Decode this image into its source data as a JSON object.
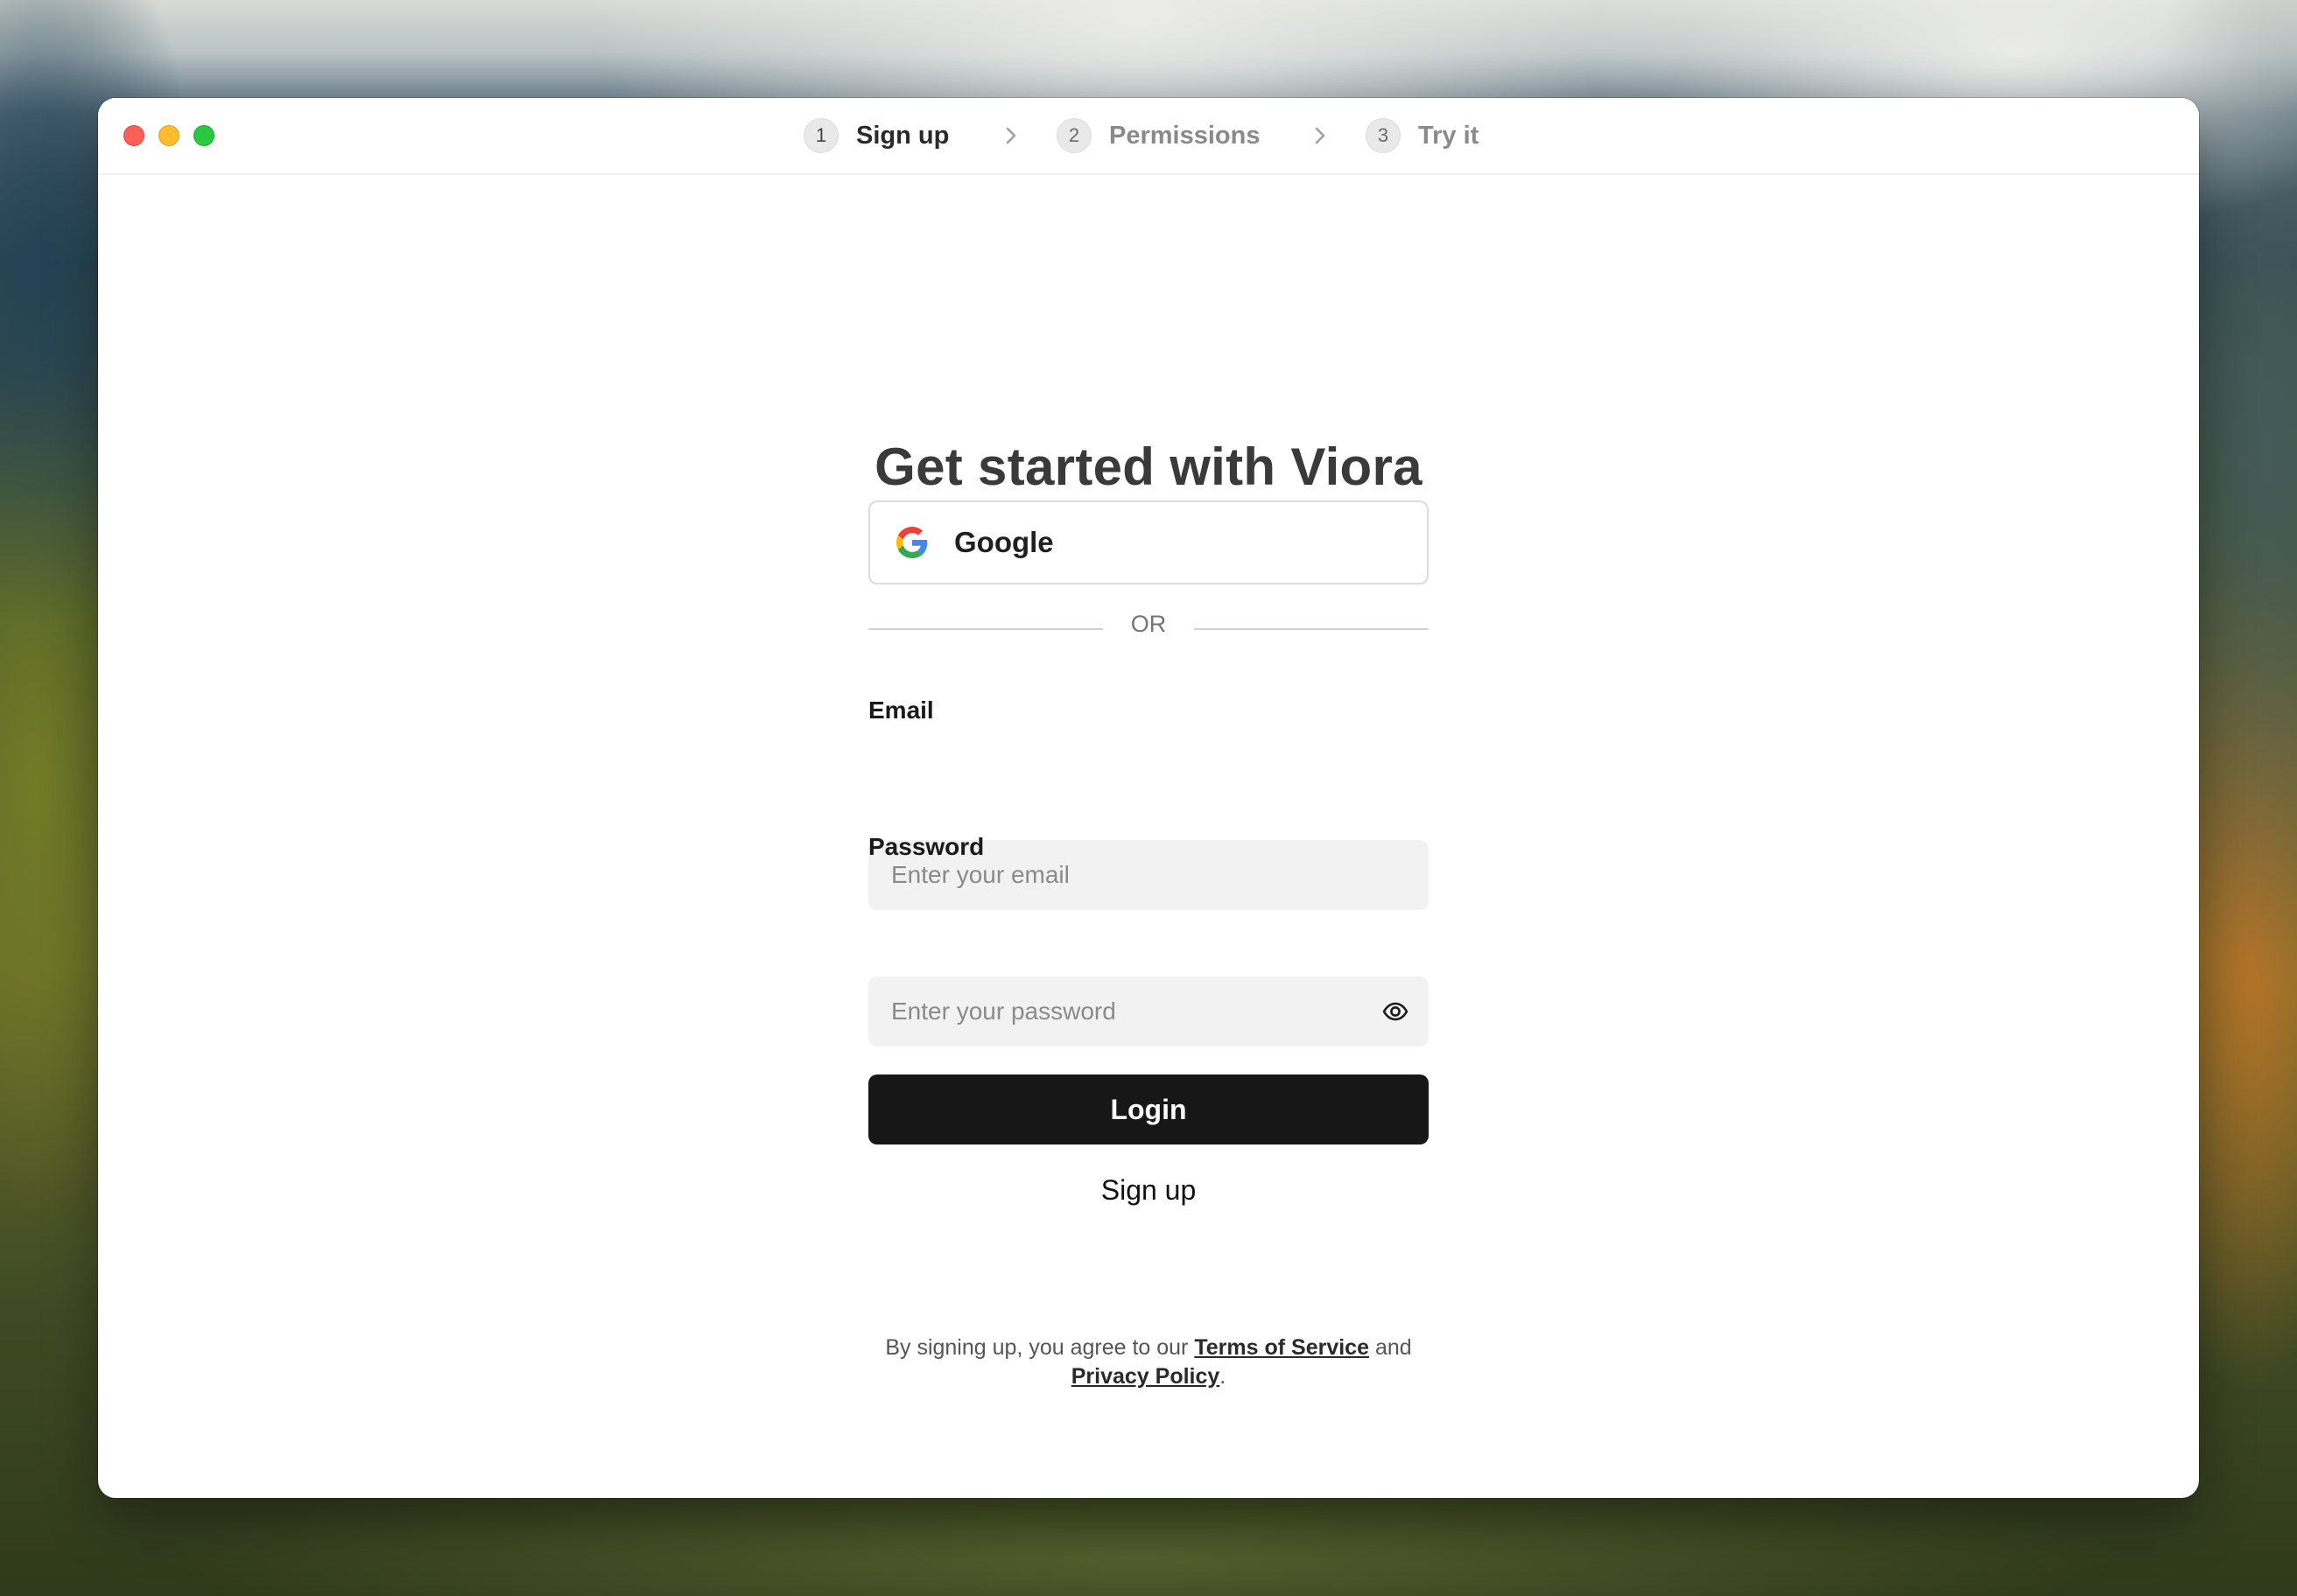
{
  "window": {
    "controls": [
      "close",
      "minimize",
      "maximize"
    ]
  },
  "stepper": {
    "steps": [
      {
        "number": "1",
        "label": "Sign up",
        "active": true
      },
      {
        "number": "2",
        "label": "Permissions",
        "active": false
      },
      {
        "number": "3",
        "label": "Try it",
        "active": false
      }
    ],
    "separator_icon": "chevron-right-icon"
  },
  "form": {
    "title": "Get started with Viora",
    "google_button": {
      "label": "Google",
      "icon": "google-icon"
    },
    "divider_text": "OR",
    "email": {
      "label": "Email",
      "placeholder": "Enter your email",
      "value": ""
    },
    "password": {
      "label": "Password",
      "placeholder": "Enter your password",
      "value": "",
      "toggle_icon": "eye-icon"
    },
    "login_label": "Login",
    "signup_label": "Sign up"
  },
  "legal": {
    "prefix": "By signing up, you agree to our",
    "terms": "Terms of Service",
    "conjunction": "and",
    "privacy": "Privacy Policy",
    "suffix": "."
  },
  "colors": {
    "primary_button": "#171717",
    "input_background": "#f2f2f2",
    "title_text": "#3a3a3a",
    "close": "#fe5f57",
    "minimize": "#febc2e",
    "maximize": "#28c840"
  }
}
